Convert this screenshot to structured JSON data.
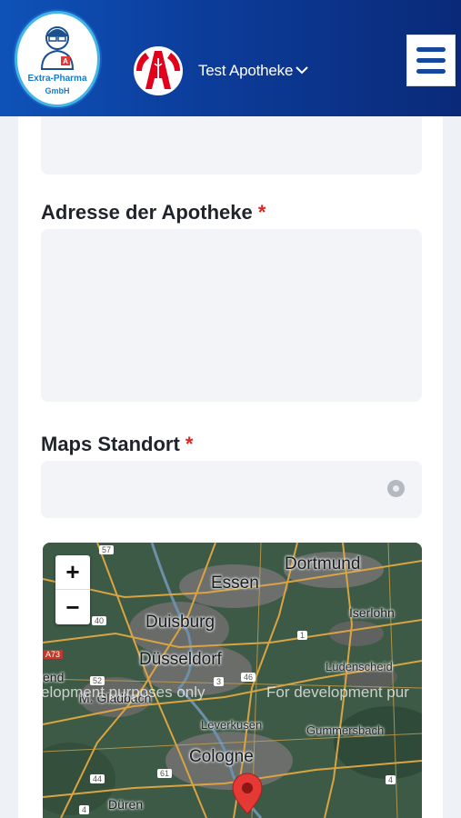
{
  "header": {
    "logo_line1": "Extra-Pharma",
    "logo_line2": "GmbH",
    "pharmacy_name": "Test Apotheke",
    "colors": {
      "bg_start": "#0e52b8",
      "bg_end": "#0a2a78",
      "menu_icon": "#13489e"
    }
  },
  "form": {
    "address_label": "Adresse der Apotheke",
    "maps_label": "Maps Standort",
    "required_marker": "*"
  },
  "map": {
    "zoom_in": "+",
    "zoom_out": "−",
    "watermark_left": "elopment purposes only",
    "watermark_right": "For development pur",
    "cities": {
      "essen": "Essen",
      "dortmund": "Dortmund",
      "duisburg": "Duisburg",
      "iserlohn": "Iserlohn",
      "duesseldorf": "Düsseldorf",
      "luedenscheid": "Lüdenscheid",
      "moenchengladbach": "M. Gladbach",
      "leverkusen": "Leverkusen",
      "gummersbach": "Gummersbach",
      "cologne": "Cologne",
      "dueren": "Düren",
      "end": "end"
    },
    "road_labels": [
      "57",
      "40",
      "A73",
      "52",
      "3",
      "46",
      "1",
      "44",
      "61",
      "4",
      "4"
    ],
    "pin_color": "#e53935"
  }
}
